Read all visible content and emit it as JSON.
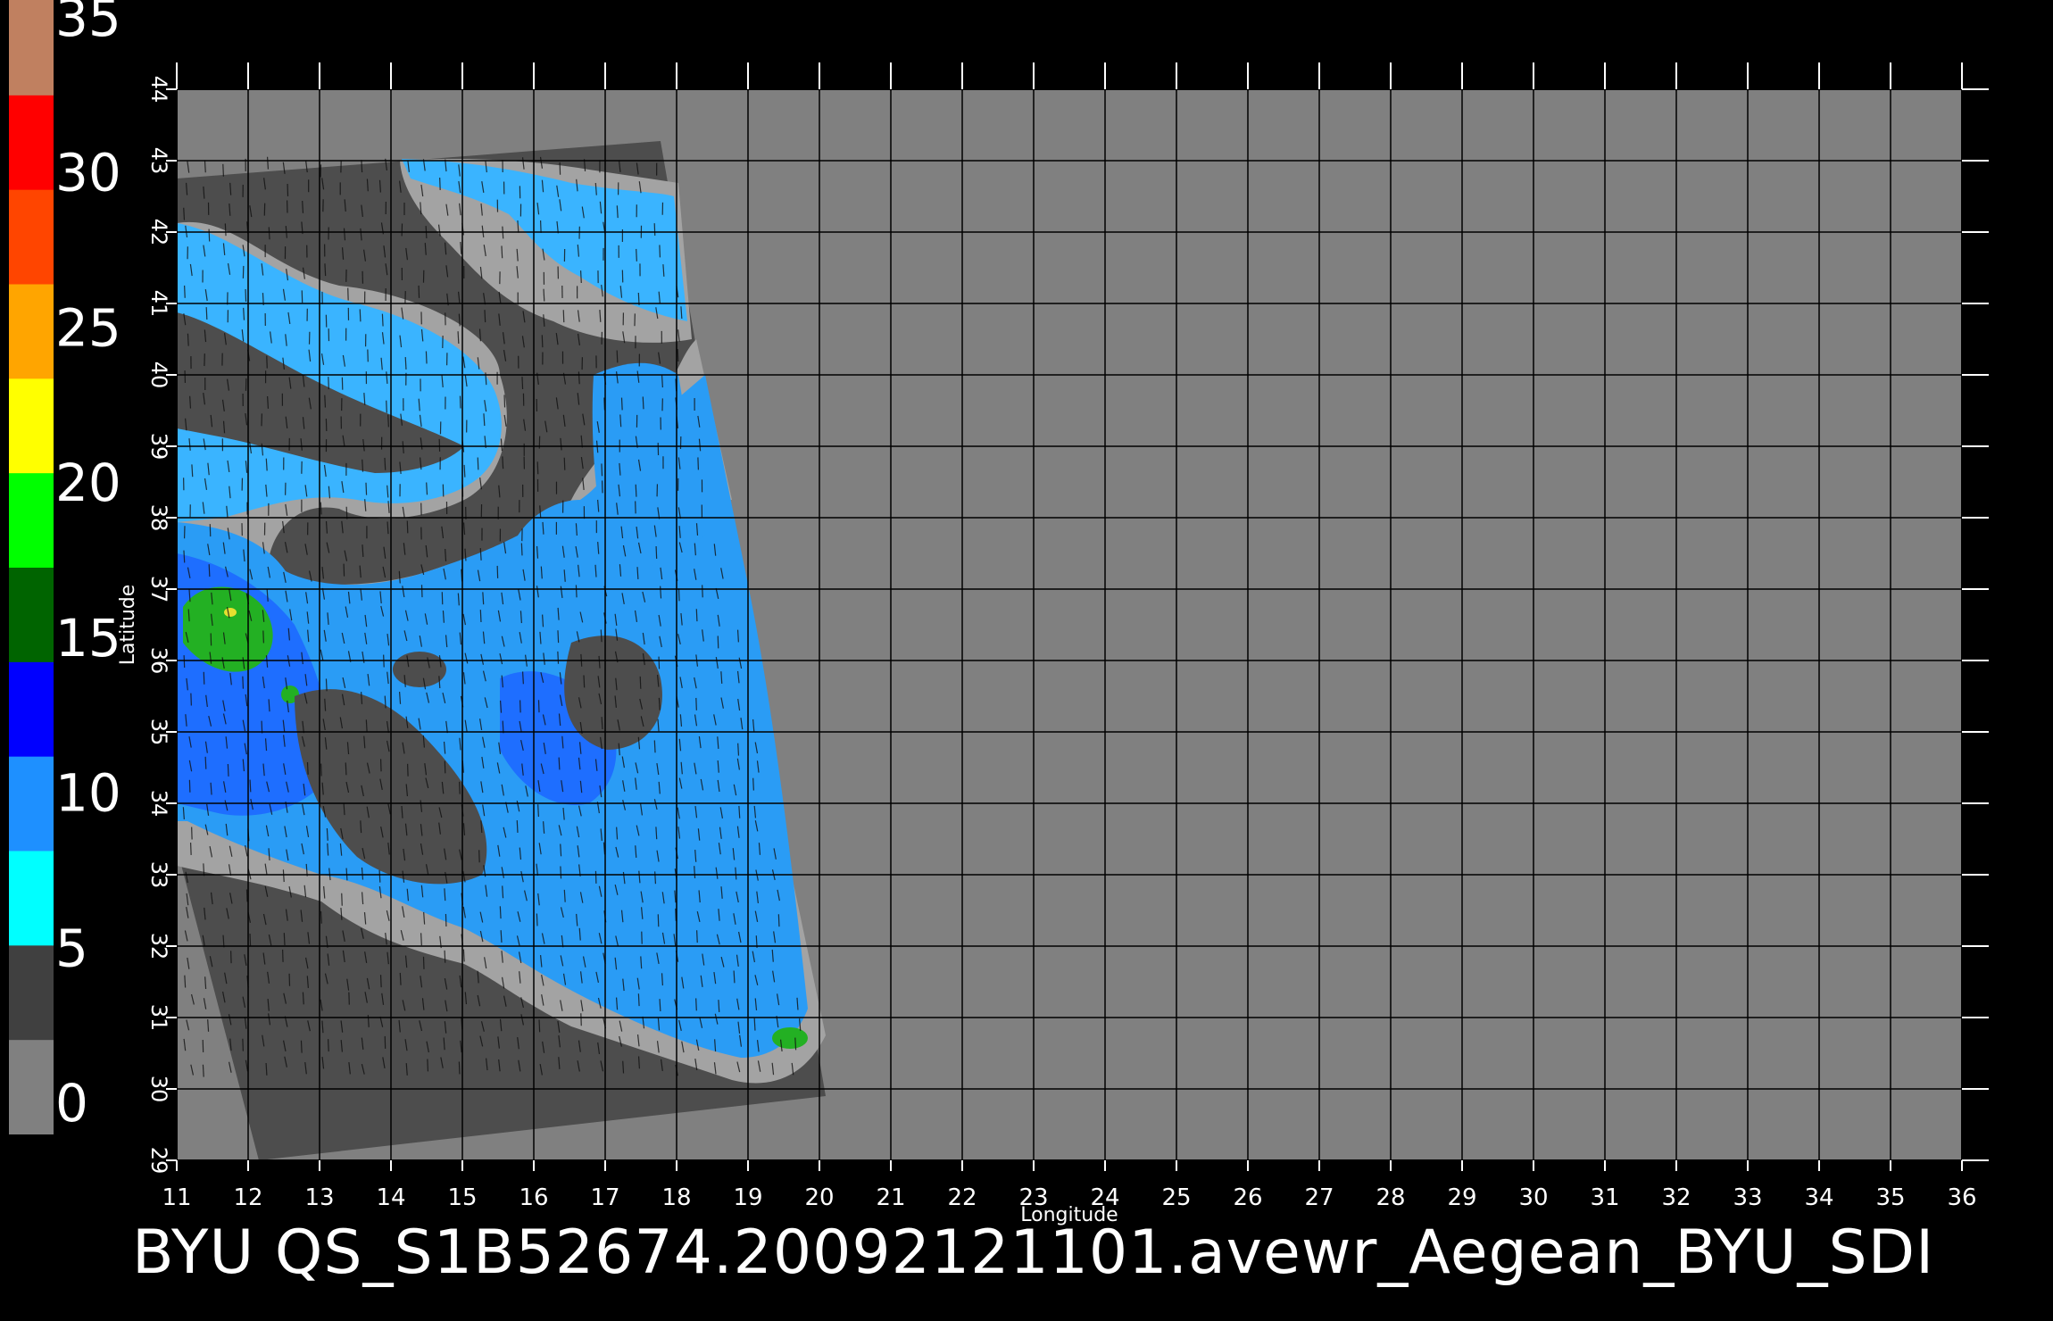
{
  "colorbar": {
    "ticks": [
      "35",
      "30",
      "25",
      "20",
      "15",
      "10",
      "5",
      "0"
    ],
    "colors": [
      "#808080",
      "#404040",
      "#00ffff",
      "#1e90ff",
      "#0000ff",
      "#006400",
      "#00ff00",
      "#ffff00",
      "#ffa500",
      "#ff4500",
      "#ff0000",
      "#c08060"
    ]
  },
  "axes": {
    "xlabel": "Longitude",
    "ylabel": "Latitude",
    "x_ticks": [
      "11",
      "12",
      "13",
      "14",
      "15",
      "16",
      "17",
      "18",
      "19",
      "20",
      "21",
      "22",
      "23",
      "24",
      "25",
      "26",
      "27",
      "28",
      "29",
      "30",
      "31",
      "32",
      "33",
      "34",
      "35",
      "36"
    ],
    "y_ticks": [
      "29",
      "30",
      "31",
      "32",
      "33",
      "34",
      "35",
      "36",
      "37",
      "38",
      "39",
      "40",
      "41",
      "42",
      "43",
      "44"
    ]
  },
  "caption": "BYU  QS_S1B52674.20092121101.avewr_Aegean_BYU_SDI",
  "colors": {
    "background": "#000000",
    "nodata_gray": "#808080",
    "land_dark": "#505050",
    "coast_gray": "#a0a0a0",
    "wind_light": "#40c8ff",
    "wind_blue": "#1e6eff",
    "wind_green": "#22b022",
    "grid": "#000000"
  }
}
